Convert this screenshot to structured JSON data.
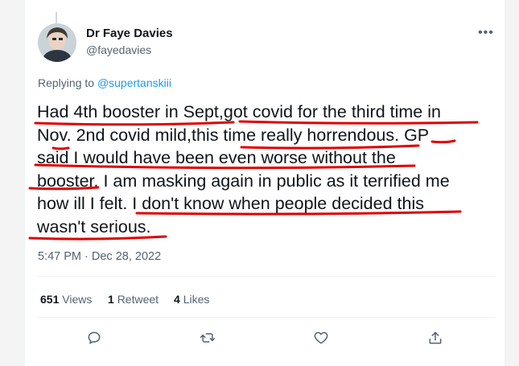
{
  "tweet": {
    "author_name": "Dr Faye Davies",
    "author_handle": "@fayedavies",
    "more_icon": "more-horizontal-icon",
    "replying_prefix": "Replying to",
    "replying_to": "@supertanskiii",
    "text_lines": [
      "Had 4th booster in Sept,got covid for the third time in",
      "Nov. 2nd covid mild,this time really horrendous. GP",
      "said I would have been even worse without the",
      "booster. I am masking again in public as it terrified me",
      "how ill I felt. I don't know when people decided this",
      "wasn't serious."
    ],
    "timestamp": "5:47 PM · Dec 28, 2022",
    "stats": {
      "views_count": "651",
      "views_label": "Views",
      "retweets_count": "1",
      "retweets_label": "Retweet",
      "likes_count": "4",
      "likes_label": "Likes"
    },
    "actions": [
      "reply-icon",
      "retweet-icon",
      "like-icon",
      "share-icon"
    ],
    "underline_color": "#e00000"
  }
}
